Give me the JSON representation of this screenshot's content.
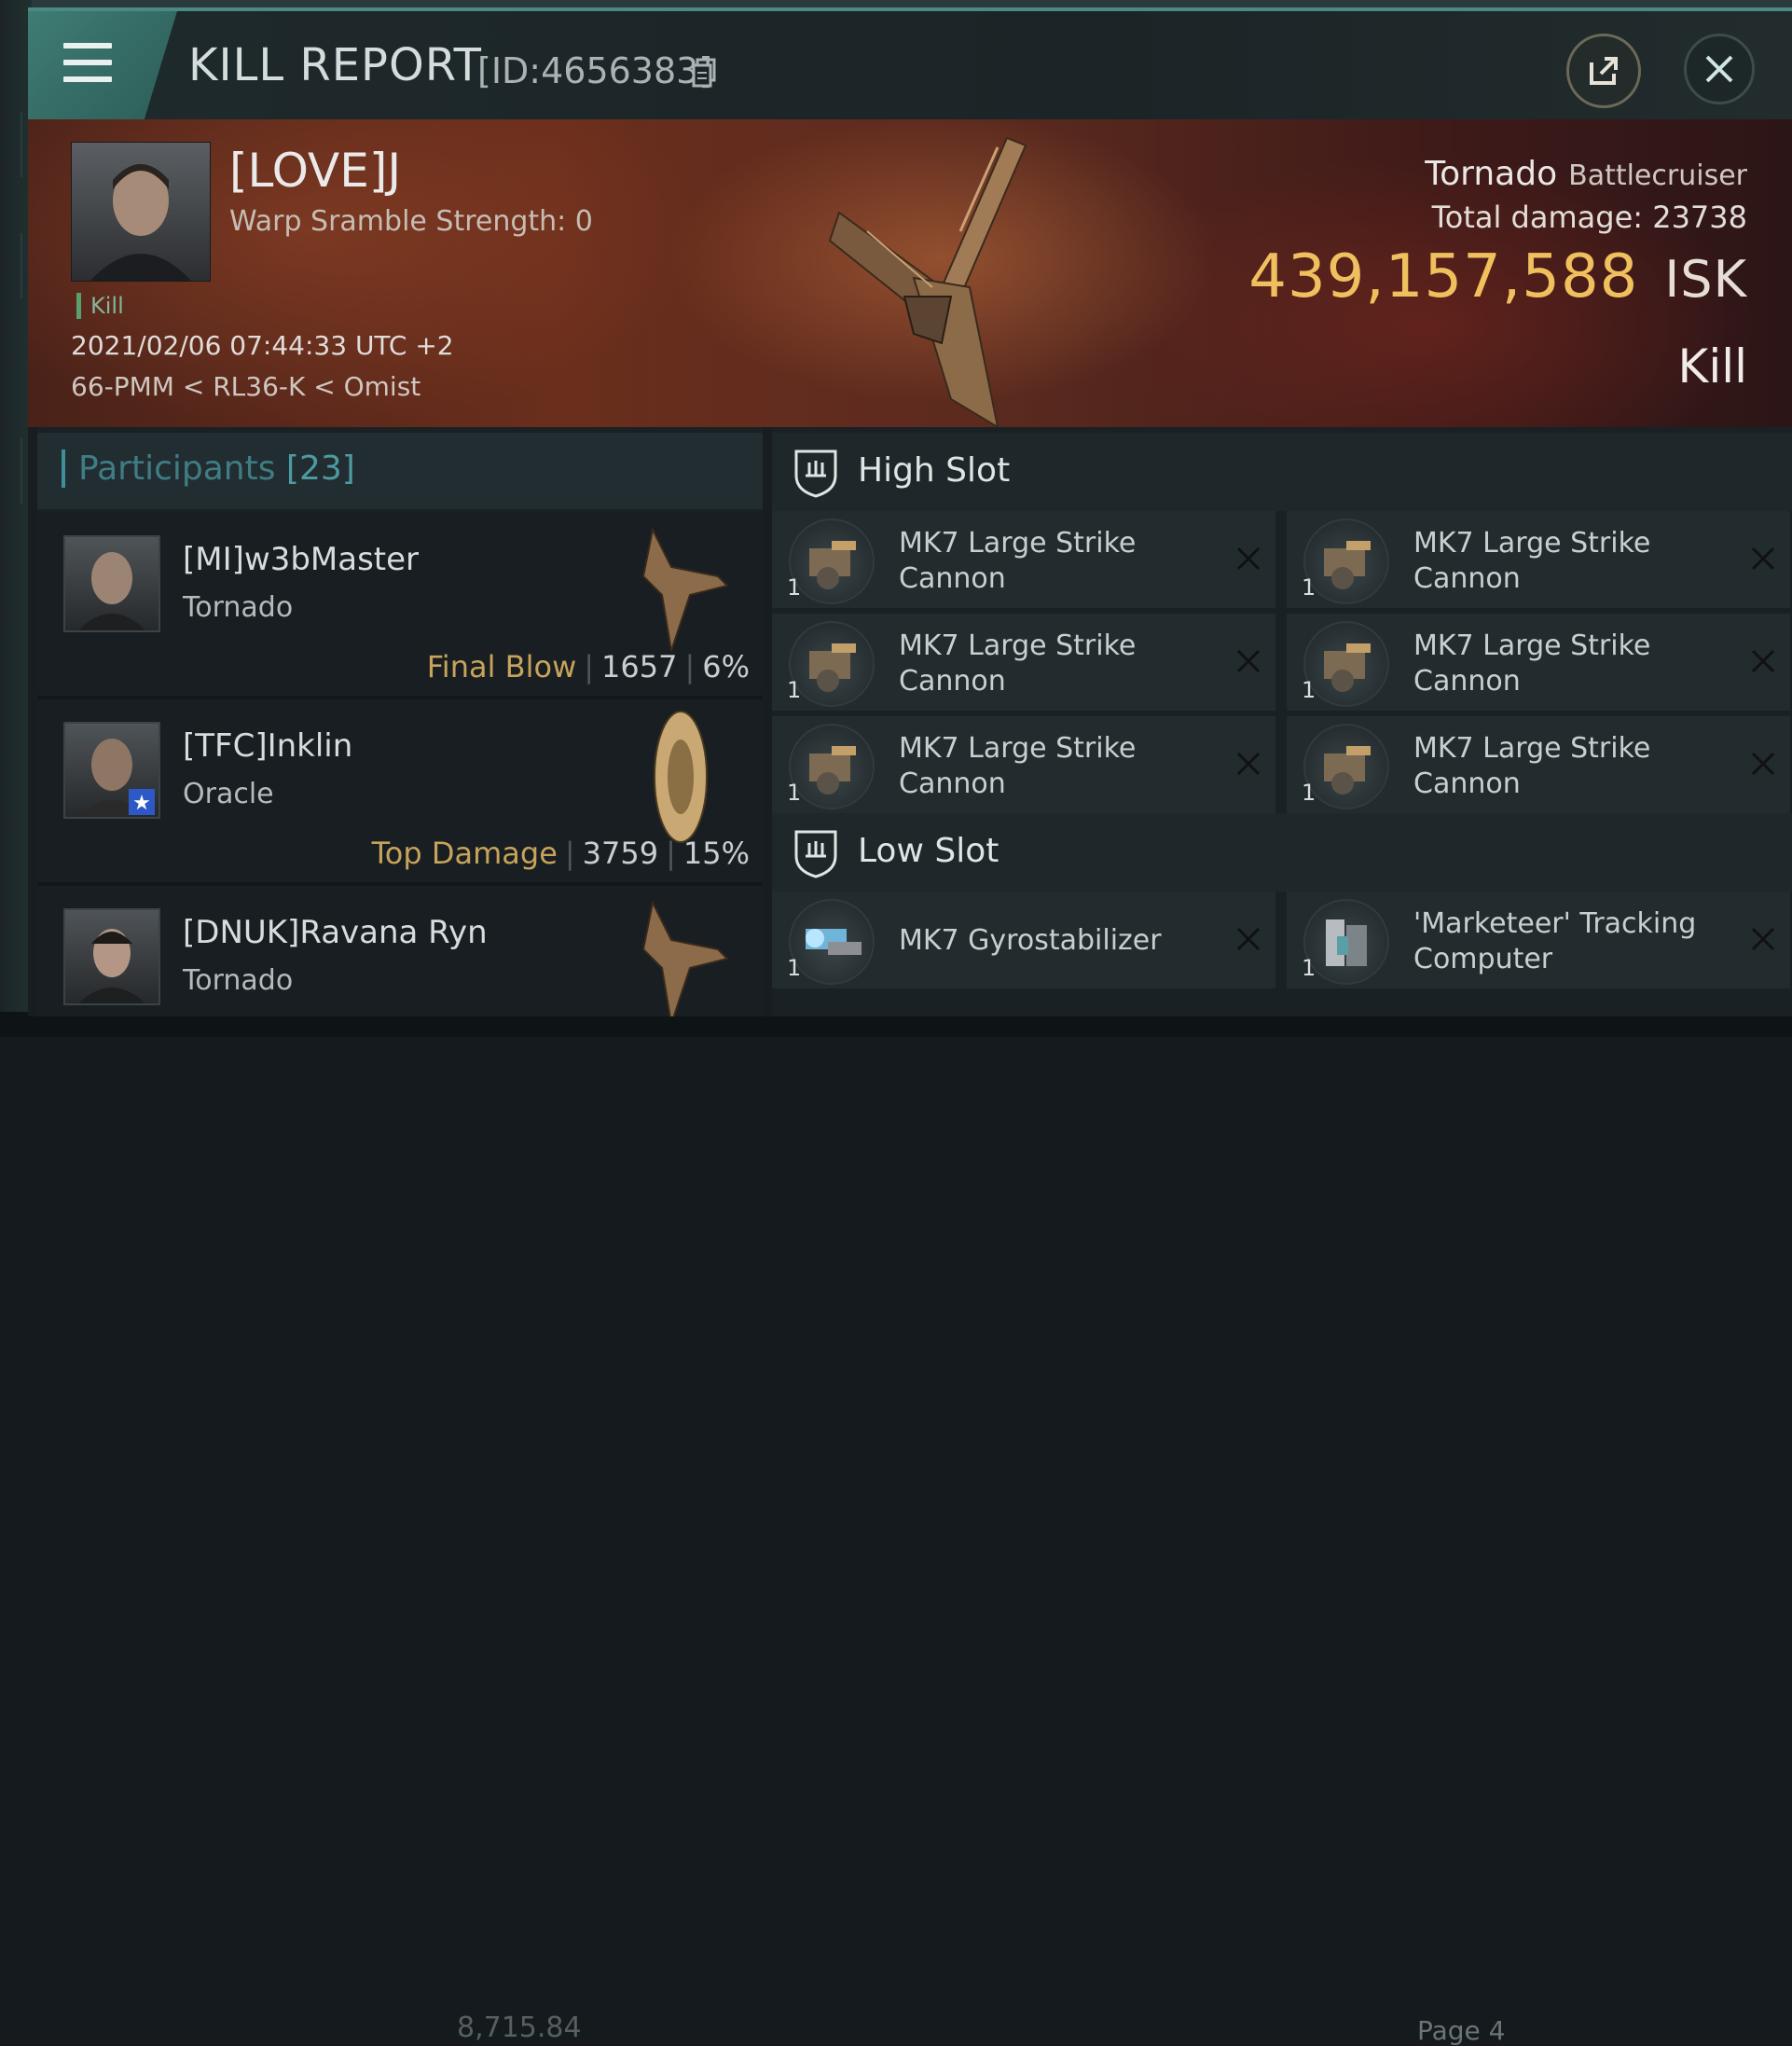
{
  "header": {
    "title": "KILL REPORT",
    "id_label": "[ID:4656383]"
  },
  "victim": {
    "name": "[LOVE]J",
    "warp_scramble": "Warp Sramble Strength: 0",
    "tag": "Kill",
    "datetime": "2021/02/06 07:44:33 UTC +2",
    "route": "66-PMM < RL36-K < Omist",
    "ship": "Tornado",
    "ship_class": "Battlecruiser",
    "total_damage": "Total damage:  23738",
    "isk_value": "439,157,588",
    "isk_unit": "ISK",
    "outcome": "Kill"
  },
  "participants": {
    "label": "Participants",
    "count": "[23]",
    "rows": [
      {
        "name": "[MI]w3bMaster",
        "ship": "Tornado",
        "tag": "Final Blow",
        "damage": "1657",
        "percent": "6%"
      },
      {
        "name": "[TFC]Inklin",
        "ship": "Oracle",
        "tag": "Top Damage",
        "damage": "3759",
        "percent": "15%"
      },
      {
        "name": "[DNUK]Ravana Ryn",
        "ship": "Tornado",
        "tag": "",
        "damage": "",
        "percent": ""
      }
    ]
  },
  "fittings": {
    "high_slot_title": "High Slot",
    "low_slot_title": "Low Slot",
    "high": [
      {
        "name": "MK7 Large Strike Cannon",
        "qty": "1"
      },
      {
        "name": "MK7 Large Strike Cannon",
        "qty": "1"
      },
      {
        "name": "MK7 Large Strike Cannon",
        "qty": "1"
      },
      {
        "name": "MK7 Large Strike Cannon",
        "qty": "1"
      },
      {
        "name": "MK7 Large Strike Cannon",
        "qty": "1"
      },
      {
        "name": "MK7 Large Strike Cannon",
        "qty": "1"
      }
    ],
    "low": [
      {
        "name": "MK7 Gyrostabilizer",
        "qty": "1"
      },
      {
        "name": "'Marketeer' Tracking Computer",
        "qty": "1"
      }
    ]
  },
  "footer": {
    "value": "8,715.84",
    "page": "Page 4"
  },
  "colors": {
    "accent": "#4a8a84",
    "isk": "#f0c05e",
    "final_blow": "#c7a35c",
    "participants_label": "#3f7d84"
  },
  "icons": {
    "menu": "hamburger-icon",
    "copy": "copy-icon",
    "share": "external-link-icon",
    "close": "close-icon",
    "slot": "slot-shield-icon",
    "remove": "x-icon"
  }
}
